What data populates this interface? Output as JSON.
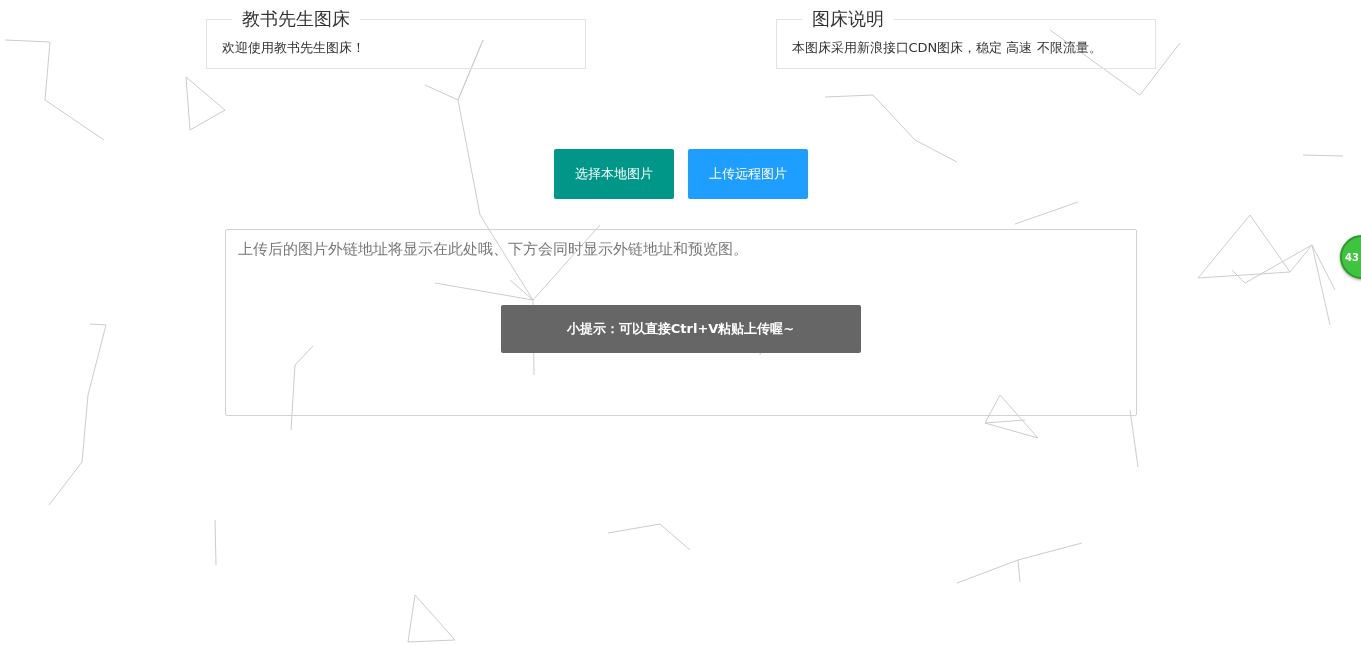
{
  "panels": [
    {
      "title": "教书先生图床",
      "text": "欢迎使用教书先生图床！"
    },
    {
      "title": "图床说明",
      "text": "本图床采用新浪接口CDN图床，稳定 高速 不限流量。"
    }
  ],
  "buttons": [
    {
      "label": "选择本地图片",
      "kind": "primary"
    },
    {
      "label": "上传远程图片",
      "kind": "secondary"
    }
  ],
  "result_box": {
    "placeholder": "上传后的图片外链地址将显示在此处哦、下方会同时显示外链地址和预览图。"
  },
  "tip": "小提示：可以直接Ctrl+V粘贴上传喔~",
  "side_badge": "43"
}
